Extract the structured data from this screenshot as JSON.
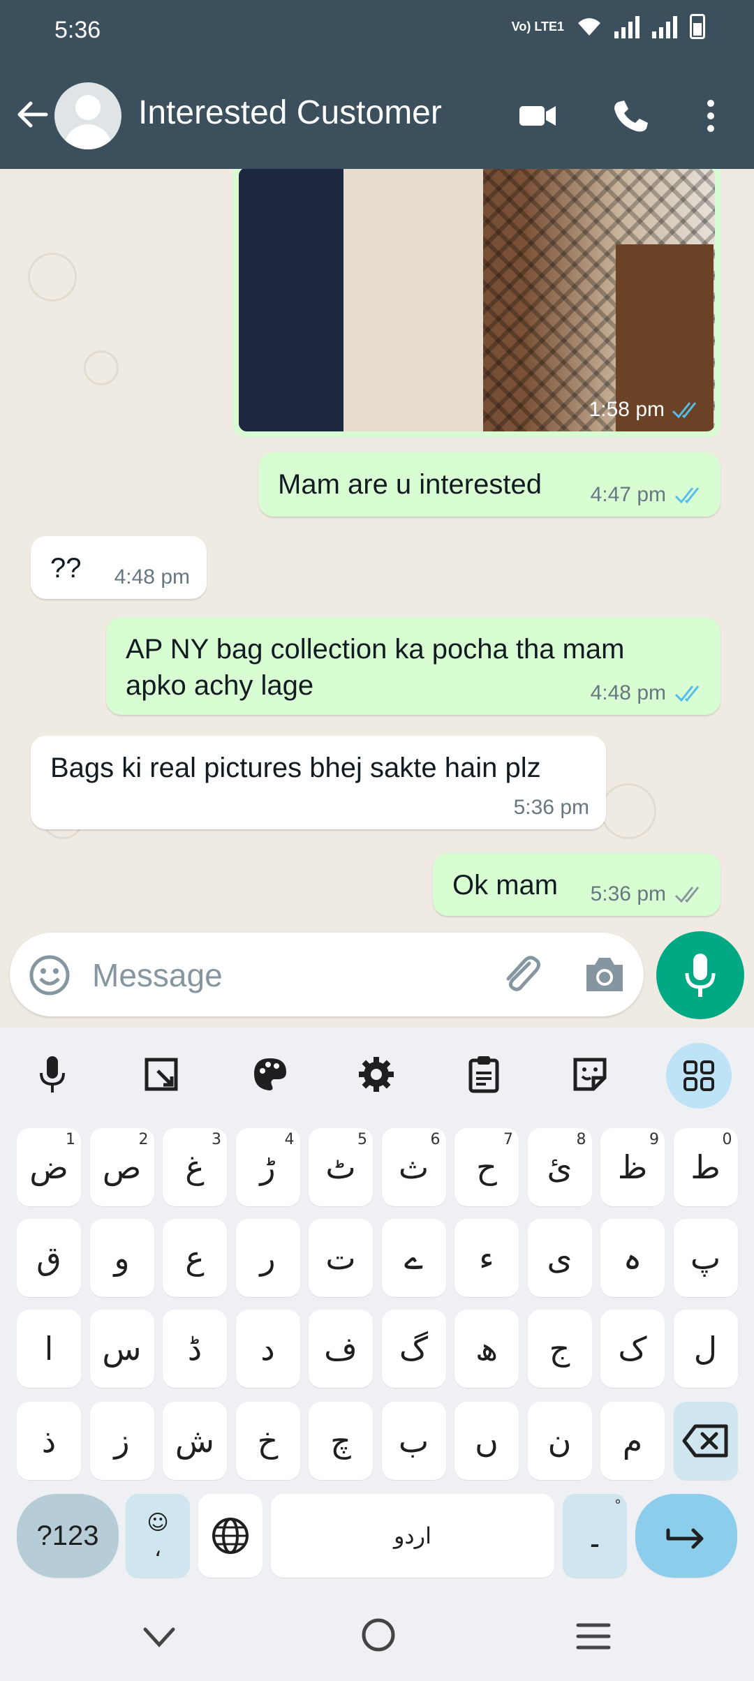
{
  "status_bar": {
    "time": "5:36",
    "network_label": "Vo) LTE1"
  },
  "header": {
    "contact_name": "Interested Customer"
  },
  "messages": [
    {
      "direction": "out",
      "type": "image",
      "time": "1:58 pm",
      "read": true
    },
    {
      "direction": "out",
      "text": "Mam are u interested",
      "time": "4:47 pm",
      "read": true
    },
    {
      "direction": "in",
      "text": "??",
      "time": "4:48 pm"
    },
    {
      "direction": "out",
      "text_lines": [
        "AP NY bag collection ka pocha tha mam",
        "apko achy lage"
      ],
      "time": "4:48 pm",
      "read": true
    },
    {
      "direction": "in",
      "text": "Bags ki real pictures bhej sakte hain plz",
      "time": "5:36 pm"
    },
    {
      "direction": "out",
      "text": "Ok mam",
      "time": "5:36 pm",
      "read": false
    }
  ],
  "composer": {
    "placeholder": "Message"
  },
  "keyboard": {
    "row1": [
      {
        "ch": "ض",
        "sup": "1"
      },
      {
        "ch": "ص",
        "sup": "2"
      },
      {
        "ch": "غ",
        "sup": "3"
      },
      {
        "ch": "ڑ",
        "sup": "4"
      },
      {
        "ch": "ٹ",
        "sup": "5"
      },
      {
        "ch": "ث",
        "sup": "6"
      },
      {
        "ch": "ح",
        "sup": "7"
      },
      {
        "ch": "ئ",
        "sup": "8"
      },
      {
        "ch": "ظ",
        "sup": "9"
      },
      {
        "ch": "ط",
        "sup": "0"
      }
    ],
    "row2": [
      "ق",
      "و",
      "ع",
      "ر",
      "ت",
      "ے",
      "ء",
      "ی",
      "ہ",
      "پ"
    ],
    "row3": [
      "ا",
      "س",
      "ڈ",
      "د",
      "ف",
      "گ",
      "ھ",
      "ج",
      "ک",
      "ل"
    ],
    "row4": [
      "ذ",
      "ز",
      "ش",
      "خ",
      "چ",
      "ب",
      "ں",
      "ن",
      "م"
    ],
    "symbols_label": "?123",
    "comma_label": "،",
    "space_label": "اردو",
    "period_label": "۔"
  },
  "colors": {
    "header": "#3b4f5c",
    "outgoing": "#d9fdd3",
    "accent": "#00a884",
    "read_tick": "#53bdeb"
  }
}
